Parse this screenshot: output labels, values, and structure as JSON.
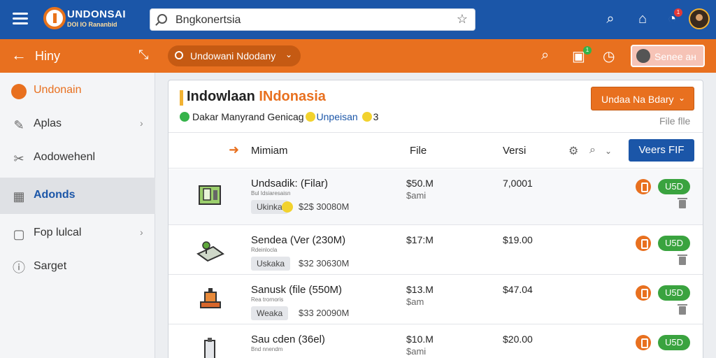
{
  "app": {
    "logo_name": "UNDONSAI",
    "logo_sub": "DOI IO Rananbid",
    "search_value": "Bngkonertsia",
    "notification_count": "1"
  },
  "toolbar": {
    "back_title": "Hiny",
    "pill_label": "Undowani Ndodany",
    "badge": "1",
    "user_label": "Senee aн"
  },
  "sidebar": {
    "items": [
      {
        "label": "Undonain",
        "icon": "circle-icon"
      },
      {
        "label": "Aplas",
        "icon": "pen-icon"
      },
      {
        "label": "Aodowehenl",
        "icon": "tool-icon"
      },
      {
        "label": "Adonds",
        "icon": "grid-icon"
      },
      {
        "label": "Fop lulcal",
        "icon": "square-icon"
      },
      {
        "label": "Sarget",
        "icon": "info-circle-icon"
      }
    ]
  },
  "main": {
    "title_part1": "Indowlaan ",
    "title_part2": "INdonasia",
    "status_text": "Dakar Manyrand Genicag",
    "status_link": "Unpeisan",
    "status_count": "3",
    "dropdown_label": "Undaa Na Bdary",
    "file_meta": "File flle",
    "headers": {
      "name": "Mimiam",
      "file": "File",
      "version": "Versi",
      "action": "Veers FIF"
    },
    "rows": [
      {
        "name": "Undsadik: (Filar)",
        "sub": "Bul Idsiaresaisn",
        "chip": "Ukinka",
        "price": "$2$ 30080M",
        "size": "$50.M",
        "unit": "$ami",
        "version": "7,0001",
        "pill": "U5D"
      },
      {
        "name": "Sendea (Ver (230M)",
        "sub": "Rdeinlocla",
        "chip": "Uskaka",
        "price": "$32 30630M",
        "size": "$17:M",
        "unit": "",
        "version": "$19.00",
        "pill": "U5D"
      },
      {
        "name": "Sanusk (file (550M)",
        "sub": "Rea trornoris",
        "chip": "Weaka",
        "price": "$33 20090M",
        "size": "$13.M",
        "unit": "$am",
        "version": "$47.04",
        "pill": "U5D"
      },
      {
        "name": "Sau cden (36el)",
        "sub": "Bnd nnendm",
        "chip": "",
        "price": "",
        "size": "$10.M",
        "unit": "$ami",
        "version": "$20.00",
        "pill": "U5D"
      }
    ]
  }
}
